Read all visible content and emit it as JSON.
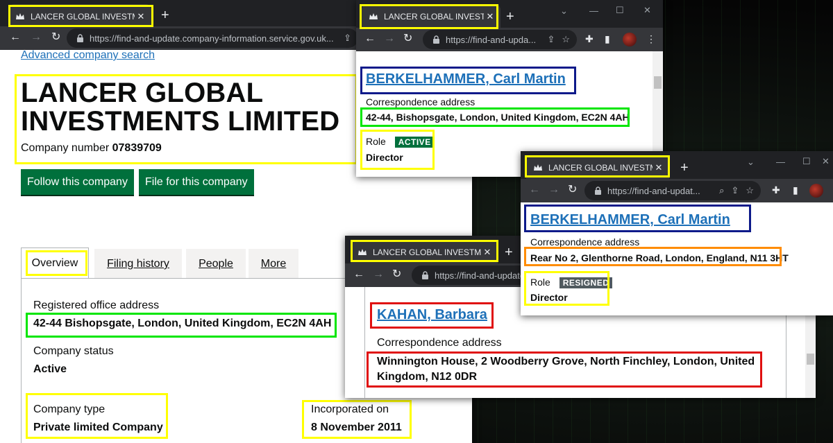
{
  "colors": {
    "highlight_yellow": "#ffff00",
    "highlight_green": "#00e600",
    "highlight_navy": "#0d1a8a",
    "highlight_red": "#e01010",
    "highlight_orange": "#ff8c00",
    "gov_green": "#00703c",
    "gov_link": "#1d70b8",
    "tag_active": "#00703c",
    "tag_resigned": "#505a5f"
  },
  "main_window": {
    "tab_title": "LANCER GLOBAL INVESTMENTS L",
    "url": "https://find-and-update.company-information.service.gov.uk...",
    "advanced_search": "Advanced company search",
    "company_name_line1": "LANCER GLOBAL",
    "company_name_line2": "INVESTMENTS LIMITED",
    "company_number_label": "Company number",
    "company_number": "07839709",
    "follow_button": "Follow this company",
    "file_button": "File for this company",
    "tabs": [
      {
        "label": "Overview"
      },
      {
        "label": "Filing history"
      },
      {
        "label": "People"
      },
      {
        "label": "More"
      }
    ],
    "registered_office_label": "Registered office address",
    "registered_office": "42-44 Bishopsgate, London, United Kingdom, EC2N 4AH",
    "status_label": "Company status",
    "status_value": "Active",
    "type_label": "Company type",
    "type_value": "Private limited Company",
    "incorporated_label": "Incorporated on",
    "incorporated_value": "8 November 2011"
  },
  "window_berkelhammer_active": {
    "tab_title": "LANCER GLOBAL INVESTMENT",
    "url": "https://find-and-upda...",
    "officer_name": "BERKELHAMMER, Carl Martin",
    "address_label": "Correspondence address",
    "address": "42-44, Bishopsgate, London, United Kingdom, EC2N 4AH",
    "role_label": "Role",
    "role_status": "ACTIVE",
    "role": "Director"
  },
  "window_berkelhammer_resigned": {
    "tab_title": "LANCER GLOBAL INVESTMENTS",
    "url": "https://find-and-updat...",
    "officer_name": "BERKELHAMMER, Carl Martin",
    "address_label": "Correspondence address",
    "address": "Rear No 2, Glenthorne Road, London, England, N11 3HT",
    "role_label": "Role",
    "role_status": "RESIGNED",
    "role": "Director"
  },
  "window_kahan": {
    "tab_title": "LANCER GLOBAL INVESTMENTS",
    "url": "https://find-and-update",
    "officer_name": "KAHAN, Barbara",
    "address_label": "Correspondence address",
    "address_line1": "Winnington House, 2 Woodberry Grove, North Finchley, London, United",
    "address_line2": "Kingdom, N12 0DR"
  }
}
